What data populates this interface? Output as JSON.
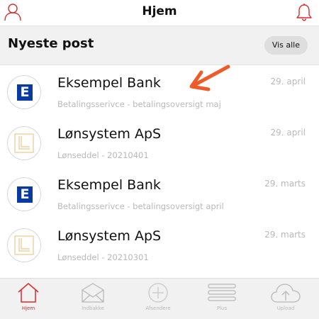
{
  "header": {
    "title": "Hjem",
    "accent_color": "#d92b2b"
  },
  "section": {
    "title": "Nyeste post",
    "see_all_label": "Vis alle"
  },
  "posts": [
    {
      "sender": "Eksempel Bank",
      "subject": "Betalingsserivce - betalingsoversigt maj",
      "date": "29. april",
      "logo": "E",
      "logo_type": "bank"
    },
    {
      "sender": "Lønsystem ApS",
      "subject": "Lønseddel - 20210401",
      "date": "29. april",
      "logo_type": "lonsystem"
    },
    {
      "sender": "Eksempel Bank",
      "subject": "Betalingsserivce - betalingsoversigt april",
      "date": "29. marts",
      "logo": "E",
      "logo_type": "bank"
    },
    {
      "sender": "Lønsystem ApS",
      "subject": "Lønseddel - 20210301",
      "date": "29. marts",
      "logo_type": "lonsystem"
    }
  ],
  "bottom_nav": {
    "items": [
      {
        "label": "Hjem",
        "icon": "home-icon",
        "active": true
      },
      {
        "label": "Indbakke",
        "icon": "envelope-icon",
        "active": false
      },
      {
        "label": "Afsendere",
        "icon": "plus-circle-icon",
        "active": false
      },
      {
        "label": "Plus",
        "icon": "stack-icon",
        "active": false
      },
      {
        "label": "Upload",
        "icon": "cloud-upload-icon",
        "active": false
      }
    ]
  },
  "colors": {
    "bank_logo": "#0a3a9e",
    "lonsystem_logo": "#e8c98a",
    "annotation_arrow": "#f05a28",
    "muted_text": "#b9b9b9"
  }
}
